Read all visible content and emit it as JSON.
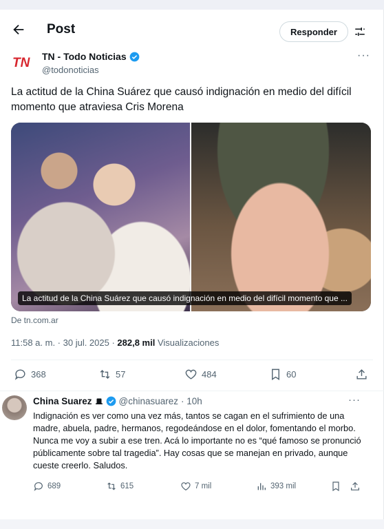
{
  "header": {
    "title": "Post",
    "reply_button": "Responder"
  },
  "post": {
    "author_name": "TN - Todo Noticias",
    "author_handle": "@todonoticias",
    "logo_text": "TN",
    "text": "La actitud de la China Suárez que causó indignación en medio del difícil momento que atraviesa Cris Morena",
    "card_caption": "La actitud de la China Suárez que causó indignación en medio del difícil momento que ...",
    "source": "De tn.com.ar",
    "time": "11:58 a. m. · 30 jul. 2025 · ",
    "views_count": "282,8 mil",
    "views_label": " Visualizaciones",
    "stats": {
      "replies": "368",
      "reposts": "57",
      "likes": "484",
      "bookmarks": "60"
    }
  },
  "reply": {
    "author_name": "China Suarez",
    "author_handle": "@chinasuarez",
    "time": "· 10h",
    "text": "Indignación es ver como una vez más, tantos se cagan en el sufrimiento de una madre, abuela, padre, hermanos, regodeándose en el dolor, fomentando el morbo. Nunca me voy a subir a ese tren. Acá lo importante no es “qué famoso se pronunció públicamente sobre tal tragedia”. Hay cosas que se manejan en privado, aunque cueste creerlo. Saludos.",
    "stats": {
      "replies": "689",
      "reposts": "615",
      "likes": "7 mil",
      "views": "393 mil"
    }
  },
  "colors": {
    "accent": "#1d9bf0",
    "logo_red": "#d7262e",
    "muted": "#536471"
  }
}
